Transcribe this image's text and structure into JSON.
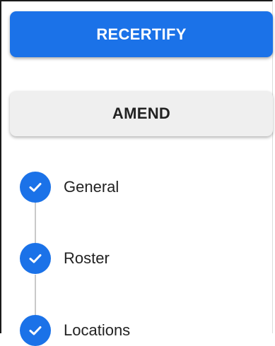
{
  "actions": {
    "recertify_label": "RECERTIFY",
    "amend_label": "AMEND"
  },
  "steps": [
    {
      "label": "General",
      "status": "complete",
      "icon": "check-icon"
    },
    {
      "label": "Roster",
      "status": "complete",
      "icon": "check-icon"
    },
    {
      "label": "Locations",
      "status": "complete",
      "icon": "check-icon"
    }
  ],
  "colors": {
    "primary": "#1b72e8",
    "secondary_button": "#efefef",
    "connector": "#c9c9c9"
  }
}
